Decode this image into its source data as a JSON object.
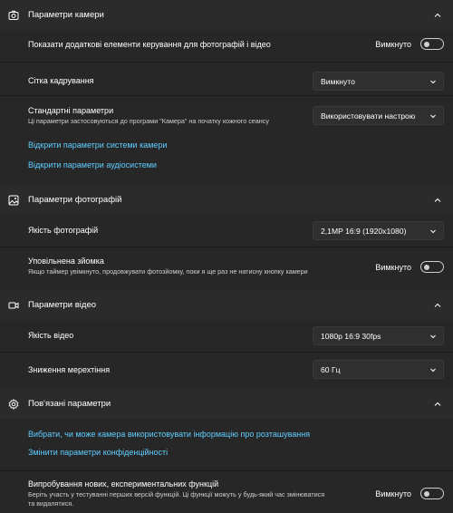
{
  "camera": {
    "title": "Параметри камери",
    "icon": "camera-settings-icon",
    "extra_controls_label": "Показати додаткові елементи керування для фотографій і відео",
    "extra_controls_state": "Вимкнуто",
    "grid_label": "Сітка кадрування",
    "grid_value": "Вимкнуто",
    "defaults_label": "Стандартні параметри",
    "defaults_sub": "Ці параметри застосовуються до програми \"Камера\" на початку кожного сеансу",
    "defaults_value": "Використовувати настрою",
    "link_camera_settings": "Відкрити параметри системи камери",
    "link_audio_settings": "Відкрити параметри аудіосистеми"
  },
  "photo": {
    "title": "Параметри фотографій",
    "icon": "photo-icon",
    "quality_label": "Якість фотографій",
    "quality_value": "2,1MP 16:9 (1920x1080)",
    "timelapse_label": "Уповільнена зйомка",
    "timelapse_sub": "Якщо таймер увімкнуто, продовжувати фотозйомку, поки я ще раз не натисну кнопку камери",
    "timelapse_state": "Вимкнуто"
  },
  "video": {
    "title": "Параметри відео",
    "icon": "video-icon",
    "quality_label": "Якість відео",
    "quality_value": "1080p 16:9 30fps",
    "flicker_label": "Зниження мерехтіння",
    "flicker_value": "60 Гц"
  },
  "related": {
    "title": "Пов'язані параметри",
    "icon": "gear-icon",
    "link_location": "Вибрати, чи може камера використовувати інформацію про розташування",
    "link_privacy": "Змінити параметри конфіденційності",
    "experimental_label": "Випробування нових, експериментальних функцій",
    "experimental_sub_line1": "Беріть участь у тестуванні перших версій функцій. Ці функції можуть у будь-який час змінюватися",
    "experimental_sub_line2": "та видалятися.",
    "experimental_state": "Вимкнуто"
  },
  "colors": {
    "background": "#1b1b1b",
    "header": "#2b2b2b",
    "panel": "#272727",
    "link": "#60cdff"
  }
}
